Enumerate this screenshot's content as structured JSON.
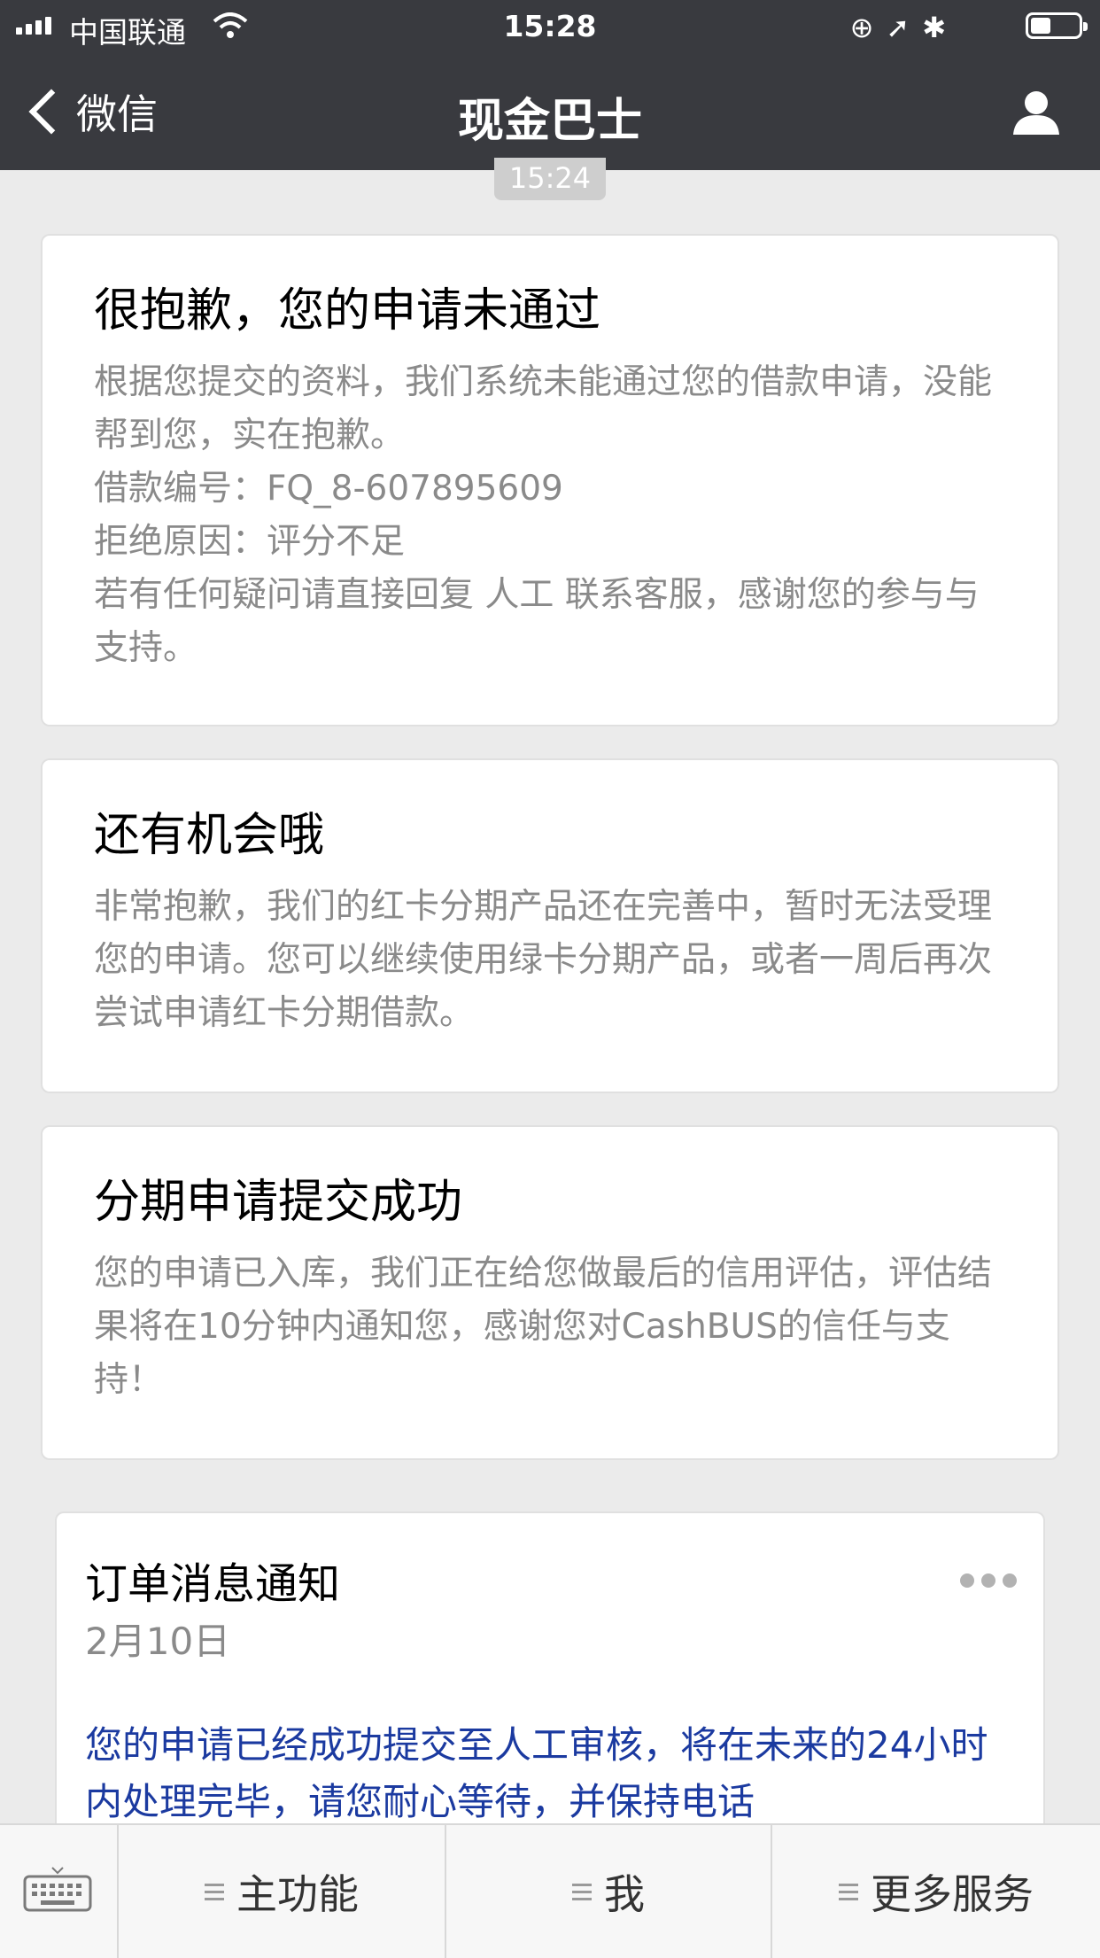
{
  "status_bar": {
    "carrier": "中国联通",
    "time": "15:28",
    "icons": [
      "rotation-lock-icon",
      "location-icon",
      "bluetooth-icon"
    ]
  },
  "nav": {
    "back_label": "微信",
    "title": "现金巴士"
  },
  "chat": {
    "timestamp": "15:24",
    "cards": [
      {
        "title": "很抱歉，您的申请未通过",
        "lines": [
          "根据您提交的资料，我们系统未能通过您的借款申请，没能帮到您，实在抱歉。",
          "借款编号：FQ_8-607895609",
          "拒绝原因：评分不足",
          "若有任何疑问请直接回复 人工 联系客服，感谢您的参与与支持。"
        ]
      },
      {
        "title": "还有机会哦",
        "lines": [
          "非常抱歉，我们的红卡分期产品还在完善中，暂时无法受理您的申请。您可以继续使用绿卡分期产品，或者一周后再次尝试申请红卡分期借款。"
        ]
      },
      {
        "title": "分期申请提交成功",
        "lines": [
          "您的申请已入库，我们正在给您做最后的信用评估，评估结果将在10分钟内通知您，感谢您对CashBUS的信任与支持！"
        ]
      }
    ],
    "template_message": {
      "title": "订单消息通知",
      "date": "2月10日",
      "body": "您的申请已经成功提交至人工审核，将在未来的24小时内处理完毕，请您耐心等待，并保持电话"
    }
  },
  "bottom_menu": {
    "items": [
      "主功能",
      "我",
      "更多服务"
    ]
  },
  "colors": {
    "nav_bg": "#393a3f",
    "page_bg": "#ebebeb",
    "template_body_text": "#1b3aa0"
  }
}
